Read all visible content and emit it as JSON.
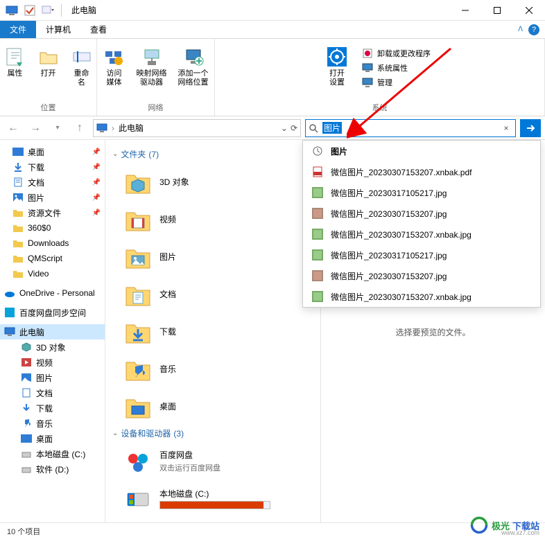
{
  "title": "此电脑",
  "tabs": {
    "file": "文件",
    "computer": "计算机",
    "view": "查看"
  },
  "ribbon": {
    "location": {
      "label": "位置",
      "properties": "属性",
      "open": "打开",
      "rename": "重命名"
    },
    "network": {
      "label": "网络",
      "access_media": "访问媒体",
      "map_drive": "映射网络\n驱动器",
      "add_location": "添加一个\n网络位置"
    },
    "system": {
      "label": "系统",
      "open_settings": "打开\n设置",
      "uninstall": "卸载或更改程序",
      "sys_props": "系统属性",
      "manage": "管理"
    }
  },
  "address": "此电脑",
  "search": {
    "query": "图片"
  },
  "search_results": {
    "heading": "图片",
    "items": [
      {
        "icon": "pdf",
        "name": "微信图片_20230307153207.xnbak.pdf"
      },
      {
        "icon": "jpg",
        "name": "微信图片_20230317105217.jpg"
      },
      {
        "icon": "jpg2",
        "name": "微信图片_20230307153207.jpg"
      },
      {
        "icon": "jpg",
        "name": "微信图片_20230307153207.xnbak.jpg"
      },
      {
        "icon": "jpg",
        "name": "微信图片_20230317105217.jpg"
      },
      {
        "icon": "jpg2",
        "name": "微信图片_20230307153207.jpg"
      },
      {
        "icon": "jpg",
        "name": "微信图片_20230307153207.xnbak.jpg"
      }
    ]
  },
  "tree": {
    "desktop": "桌面",
    "downloads": "下载",
    "documents": "文档",
    "pictures": "图片",
    "res_files": "资源文件",
    "360s0": "360$0",
    "downloads_en": "Downloads",
    "qmscript": "QMScript",
    "video_en": "Video",
    "onedrive": "OneDrive - Personal",
    "baidu_sync": "百度网盘同步空间",
    "thispc": "此电脑",
    "3dobj": "3D 对象",
    "videos": "视频",
    "pictures2": "图片",
    "documents2": "文档",
    "downloads2": "下载",
    "music": "音乐",
    "desktop2": "桌面",
    "localc": "本地磁盘 (C:)",
    "soft_d": "软件 (D:)"
  },
  "sections": {
    "folders": {
      "label": "文件夹",
      "count": "(7)"
    },
    "drives": {
      "label": "设备和驱动器",
      "count": "(3)"
    }
  },
  "folders": {
    "3dobj": "3D 对象",
    "videos": "视频",
    "pictures": "图片",
    "documents": "文档",
    "downloads": "下载",
    "music": "音乐",
    "desktop": "桌面"
  },
  "drives": {
    "baidu": {
      "name": "百度网盘",
      "sub": "双击运行百度网盘"
    },
    "localc": {
      "name": "本地磁盘 (C:)"
    }
  },
  "preview_text": "选择要预览的文件。",
  "status": "10 个项目",
  "watermark": {
    "t1": "极光",
    "t2": "下载站",
    "url": "www.xz7.com"
  }
}
